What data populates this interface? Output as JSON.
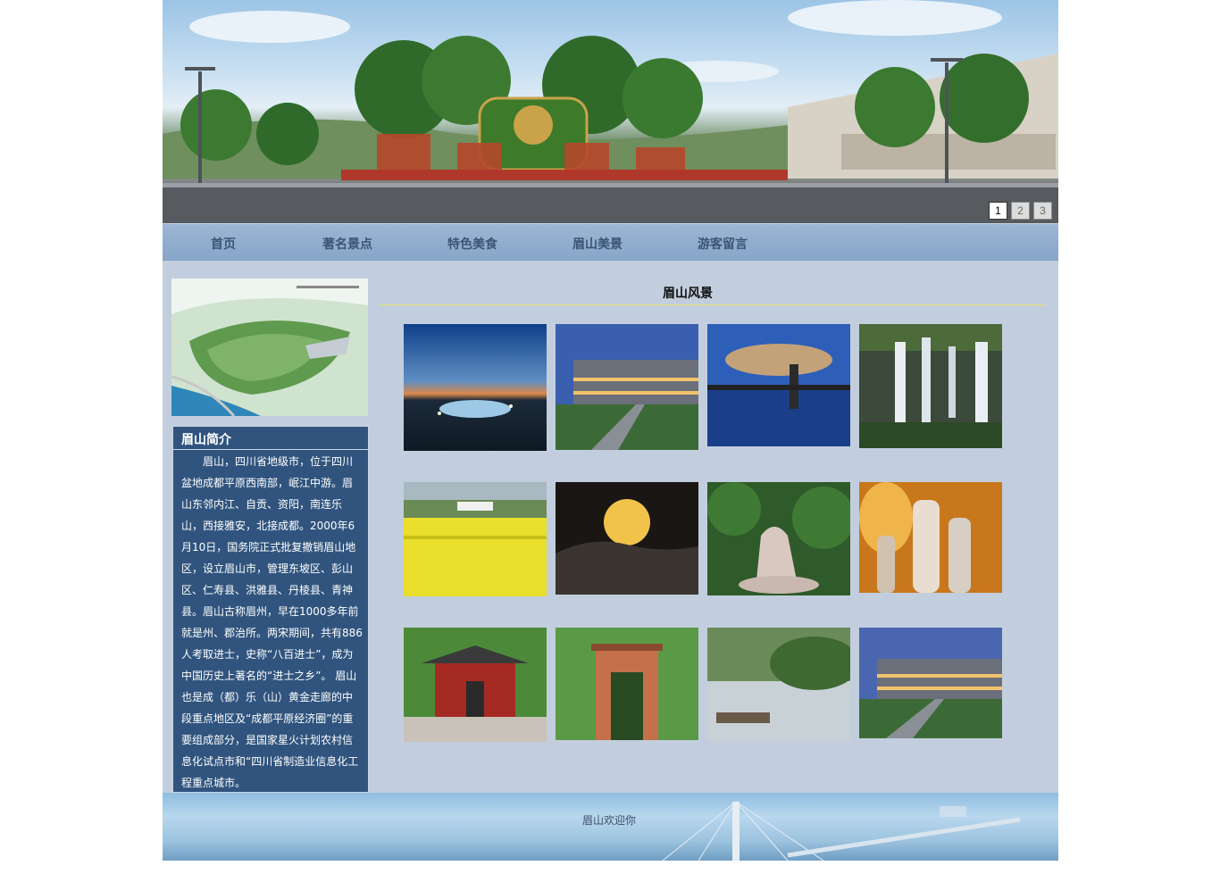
{
  "banner": {
    "pager": [
      {
        "label": "1",
        "active": true
      },
      {
        "label": "2",
        "active": false
      },
      {
        "label": "3",
        "active": false
      }
    ]
  },
  "nav": {
    "items": [
      "首页",
      "著名景点",
      "特色美食",
      "眉山美景",
      "游客留言"
    ]
  },
  "sidebar": {
    "intro_title": "眉山简介",
    "intro_text": "眉山，四川省地级市，位于四川盆地成都平原西南部，岷江中游。眉山东邻内江、自贡、资阳，南连乐山，西接雅安，北接成都。2000年6月10日，国务院正式批复撤销眉山地区，设立眉山市，管理东坡区、彭山区、仁寿县、洪雅县、丹棱县、青神县。眉山古称眉州，早在1000多年前就是州、郡治所。两宋期间，共有886人考取进士，史称“八百进士”，成为中国历史上著名的“进士之乡”。 眉山也是成（都）乐（山）黄金走廊的中段重点地区及“成都平原经济圈”的重要组成部分，是国家星火计划农村信息化试点市和“四川省制造业信息化工程重点城市。"
  },
  "main": {
    "title": "眉山风景"
  },
  "footer": {
    "text": "眉山欢迎你"
  }
}
